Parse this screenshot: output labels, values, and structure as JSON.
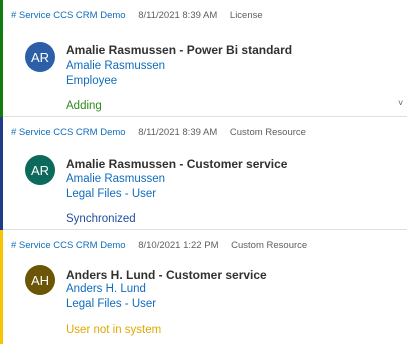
{
  "cards": [
    {
      "source": "# Service CCS CRM Demo",
      "date": "8/11/2021 8:39 AM",
      "type": "License",
      "initials": "AR",
      "title": "Amalie Rasmussen - Power Bi standard",
      "name": "Amalie Rasmussen",
      "detail": "Employee",
      "status": "Adding",
      "avatar_color": "#2b5fa8",
      "accent_color": "#107c10",
      "status_color": "#2e8b1d"
    },
    {
      "source": "# Service CCS CRM Demo",
      "date": "8/11/2021 8:39 AM",
      "type": "Custom Resource",
      "initials": "AR",
      "title": "Amalie Rasmussen - Customer service",
      "name": "Amalie Rasmussen",
      "detail": "Legal Files - User",
      "status": "Synchronized",
      "avatar_color": "#0b6a5b",
      "accent_color": "#1f3c88",
      "status_color": "#1f4e9c"
    },
    {
      "source": "# Service CCS CRM Demo",
      "date": "8/10/2021 1:22 PM",
      "type": "Custom Resource",
      "initials": "AH",
      "title": "Anders H. Lund - Customer service",
      "name": "Anders H. Lund",
      "detail": "Legal Files - User",
      "status": "User not in system",
      "avatar_color": "#6b5507",
      "accent_color": "#f7c600",
      "status_color": "#e0a800"
    }
  ]
}
